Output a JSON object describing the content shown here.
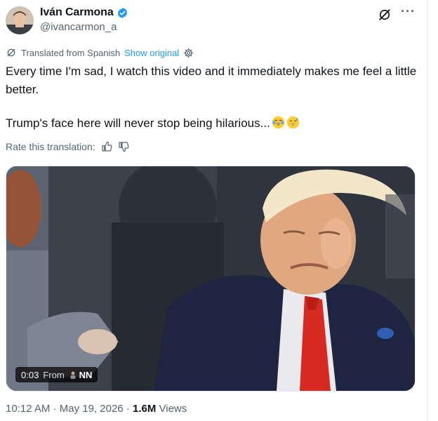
{
  "author": {
    "name": "Iván Carmona",
    "handle": "@ivancarmon_a",
    "verified": true
  },
  "translation": {
    "note": "Translated from Spanish",
    "show_original": "Show original"
  },
  "post": {
    "line1": "Every time I'm sad, I watch this video and it immediately makes me feel a little better.",
    "line2": "Trump's face here will never stop being hilarious..."
  },
  "rate": {
    "label": "Rate this translation:"
  },
  "video": {
    "time": "0:03",
    "from_label": "From",
    "source": "NN"
  },
  "meta": {
    "time": "10:12 AM",
    "date": "May 19, 2026",
    "views_count": "1.6M",
    "views_label": "Views"
  },
  "icons": {
    "verified": "verified-badge-icon",
    "grok": "grok-icon",
    "more": "more-icon",
    "translate": "translate-icon",
    "settings": "gear-icon",
    "thumbs_up": "thumbs-up-icon",
    "thumbs_down": "thumbs-down-icon"
  },
  "colors": {
    "accent": "#1d9bf0",
    "secondary_text": "#536471",
    "primary_text": "#0f1419"
  }
}
